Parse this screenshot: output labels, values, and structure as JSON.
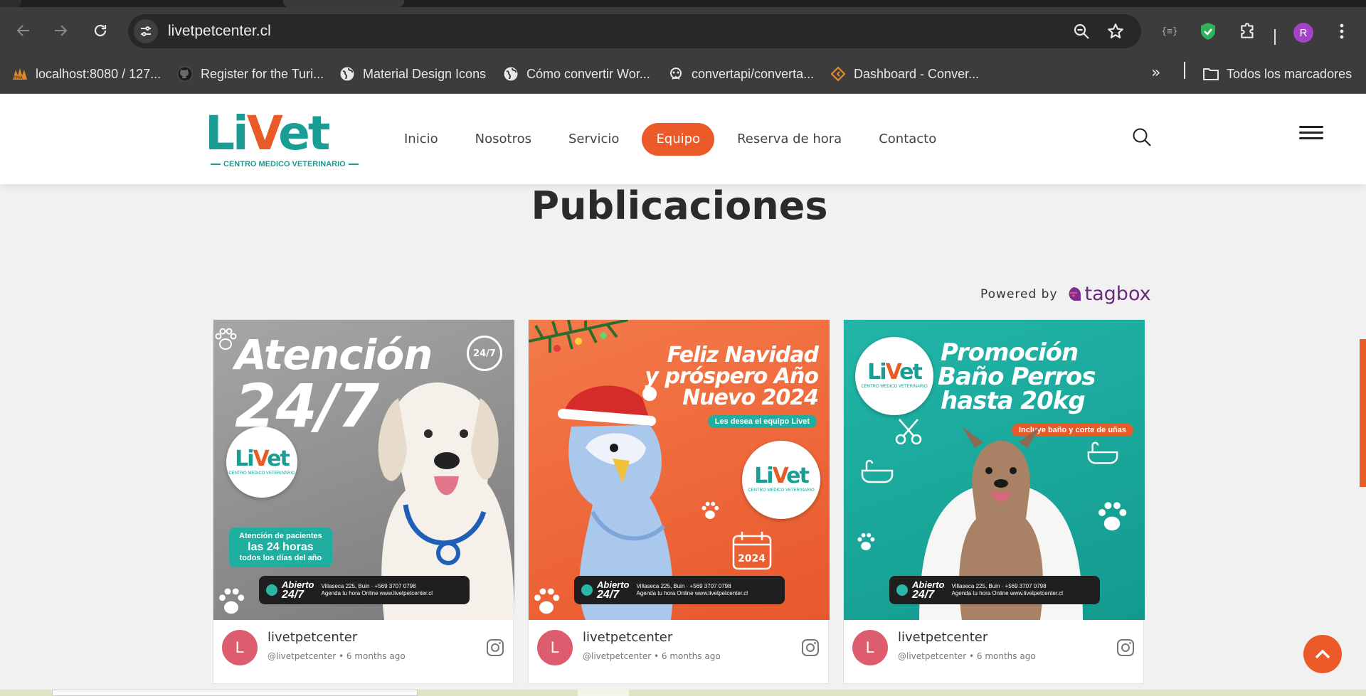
{
  "browser": {
    "url": "livetpetcenter.cl",
    "avatar_letter": "R",
    "bookmarks": [
      {
        "label": "localhost:8080 / 127...",
        "icon": "phpmyadmin-icon"
      },
      {
        "label": "Register for the Turi...",
        "icon": "github-icon"
      },
      {
        "label": "Material Design Icons",
        "icon": "globe-icon"
      },
      {
        "label": "Cómo convertir Wor...",
        "icon": "globe-icon"
      },
      {
        "label": "convertapi/converta...",
        "icon": "convertapi-icon"
      },
      {
        "label": "Dashboard - Conver...",
        "icon": "converter-icon"
      }
    ],
    "all_bookmarks_label": "Todos los marcadores"
  },
  "site": {
    "logo_text": "LiVet",
    "logo_subtitle": "CENTRO MEDICO VETERINARIO",
    "nav": [
      {
        "label": "Inicio",
        "active": false
      },
      {
        "label": "Nosotros",
        "active": false
      },
      {
        "label": "Servicio",
        "active": false
      },
      {
        "label": "Equipo",
        "active": true
      },
      {
        "label": "Reserva de hora",
        "active": false
      },
      {
        "label": "Contacto",
        "active": false
      }
    ],
    "accent_color": "#ec5a2a",
    "teal_color": "#1a9d94"
  },
  "section": {
    "title": "Publicaciones",
    "powered_by_label": "Powered by",
    "powered_by_brand": "tagbox"
  },
  "posts": [
    {
      "bg_color": "#8f8f8f",
      "headline_1": "Atención",
      "headline_2": "24/7",
      "corner_badge": "24/7",
      "sticker": "LiVet",
      "sticker_sub": "CENTRO MEDICO VETERINARIO",
      "pill_1": "Atención de pacientes",
      "pill_2": "las 24 horas",
      "pill_3": "todos los días del año",
      "info_open_1": "Abierto",
      "info_open_2": "24/7",
      "info_location": "Villaseca 225, Buin",
      "info_phone": "+569 3707 0798",
      "info_web": "Agenda tu hora Online www.livetpetcenter.cl",
      "author": "livetpetcenter",
      "avatar_letter": "L",
      "handle": "@livetpetcenter",
      "time": "6 months ago"
    },
    {
      "bg_color": "#ef6a3d",
      "headline_1": "Feliz Navidad",
      "headline_2": "y próspero Año",
      "headline_3": "Nuevo 2024",
      "pill_1": "Les desea el equipo Livet",
      "sticker": "LiVet",
      "sticker_sub": "CENTRO MEDICO VETERINARIO",
      "calendar_label": "2024",
      "info_open_1": "Abierto",
      "info_open_2": "24/7",
      "info_location": "Villaseca 225, Buin",
      "info_phone": "+569 3707 0798",
      "info_web": "Agenda tu hora Online www.livetpetcenter.cl",
      "author": "livetpetcenter",
      "avatar_letter": "L",
      "handle": "@livetpetcenter",
      "time": "6 months ago"
    },
    {
      "bg_color": "#1aada0",
      "headline_1": "Promoción",
      "headline_2": "Baño Perros",
      "headline_3": "hasta 20kg",
      "pill_1": "Incluye baño y corte de uñas",
      "sticker": "LiVet",
      "sticker_sub": "CENTRO MEDICO VETERINARIO",
      "info_open_1": "Abierto",
      "info_open_2": "24/7",
      "info_location": "Villaseca 225, Buin",
      "info_phone": "+569 3707 0798",
      "info_web": "Agenda tu hora Online www.livetpetcenter.cl",
      "author": "livetpetcenter",
      "avatar_letter": "L",
      "handle": "@livetpetcenter",
      "time": "6 months ago"
    }
  ]
}
